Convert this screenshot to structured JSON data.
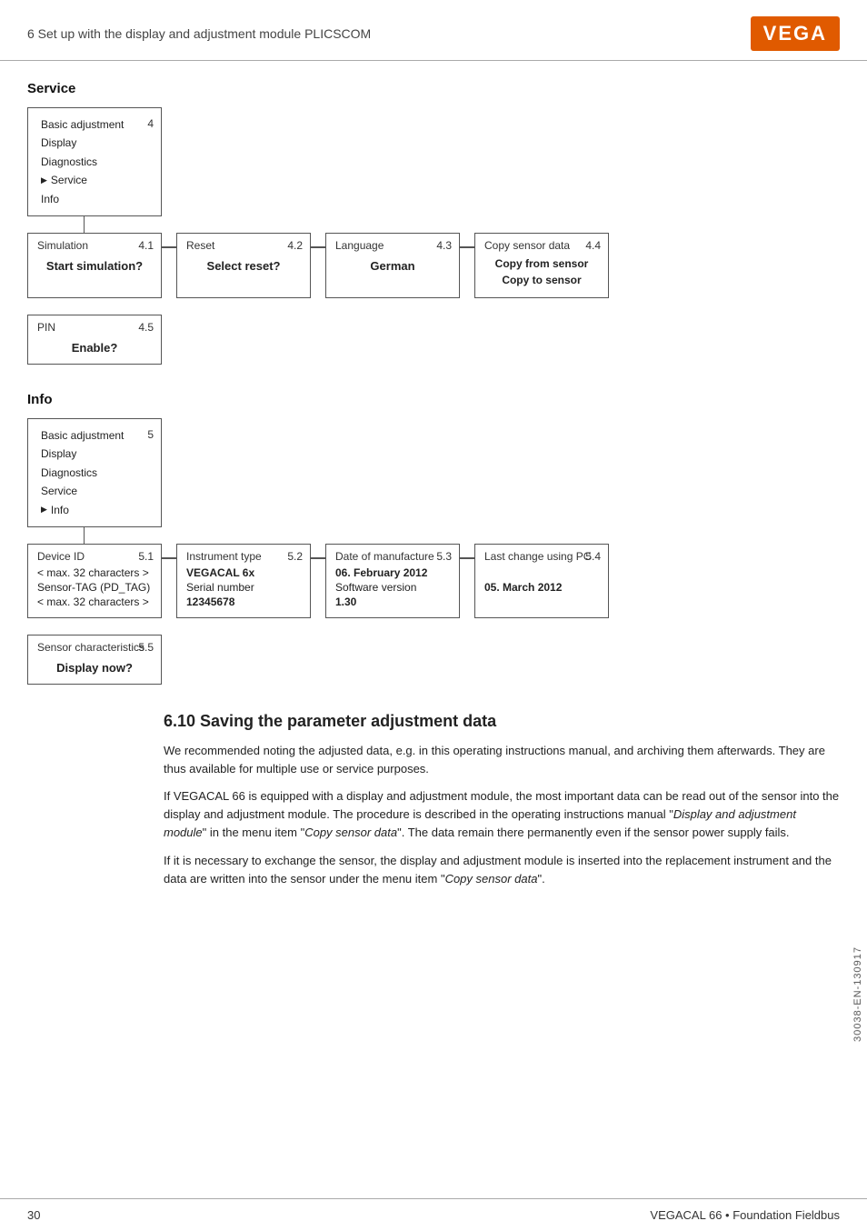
{
  "header": {
    "title": "6 Set up with the display and adjustment module PLICSCOM",
    "logo": "VEGA",
    "logo_bg": "#e05a00"
  },
  "service_section": {
    "title": "Service",
    "menu": {
      "items": [
        "Basic adjustment",
        "Display",
        "Diagnostics",
        "Service",
        "Info"
      ],
      "active": "Service",
      "number": "4"
    },
    "sub_boxes": [
      {
        "title": "Simulation",
        "number": "4.1",
        "content": "Start simulation?"
      },
      {
        "title": "Reset",
        "number": "4.2",
        "content": "Select reset?"
      },
      {
        "title": "Language",
        "number": "4.3",
        "content": "German"
      },
      {
        "title": "Copy sensor data",
        "number": "4.4",
        "content_lines": [
          "Copy from sensor",
          "Copy to sensor"
        ]
      }
    ],
    "sub_boxes2": [
      {
        "title": "PIN",
        "number": "4.5",
        "content": "Enable?"
      }
    ]
  },
  "info_section": {
    "title": "Info",
    "menu": {
      "items": [
        "Basic adjustment",
        "Display",
        "Diagnostics",
        "Service",
        "Info"
      ],
      "active": "Info",
      "number": "5"
    },
    "sub_boxes": [
      {
        "title": "Device ID",
        "number": "5.1",
        "rows": [
          "< max. 32 characters >",
          "Sensor-TAG (PD_TAG)",
          "< max. 32 characters >"
        ]
      },
      {
        "title": "Instrument type",
        "number": "5.2",
        "rows": [
          "VEGACAL 6x",
          "Serial number",
          "12345678"
        ]
      },
      {
        "title": "Date of manufacture",
        "number": "5.3",
        "rows": [
          "06. February 2012",
          "Software version",
          "1.30"
        ]
      },
      {
        "title": "Last change using PC",
        "number": "5.4",
        "rows": [
          "",
          "05. March 2012",
          ""
        ]
      }
    ],
    "sub_boxes2": [
      {
        "title": "Sensor characteristics",
        "number": "5.5",
        "content": "Display now?"
      }
    ]
  },
  "section_6_10": {
    "heading": "6.10  Saving the parameter adjustment data",
    "paragraphs": [
      "We recommended noting the adjusted data, e.g. in this operating instructions manual, and archiving them afterwards. They are thus available for multiple use or service purposes.",
      "If VEGACAL 66 is equipped with a display and adjustment module, the most important data can be read out of the sensor into the display and adjustment module. The procedure is described in the operating instructions manual \"Display and adjustment module\" in the menu item \"Copy sensor data\". The data remain there permanently even if the sensor power supply fails.",
      "If it is necessary to exchange the sensor, the display and adjustment module is inserted into the replacement instrument and the data are written into the sensor under the menu item \"Copy sensor data\"."
    ],
    "italic_spans": [
      "Display and adjustment module",
      "Copy sensor data",
      "Copy sensor data"
    ]
  },
  "footer": {
    "page_number": "30",
    "product": "VEGACAL 66 • Foundation Fieldbus"
  },
  "side_label": "30038-EN-130917"
}
